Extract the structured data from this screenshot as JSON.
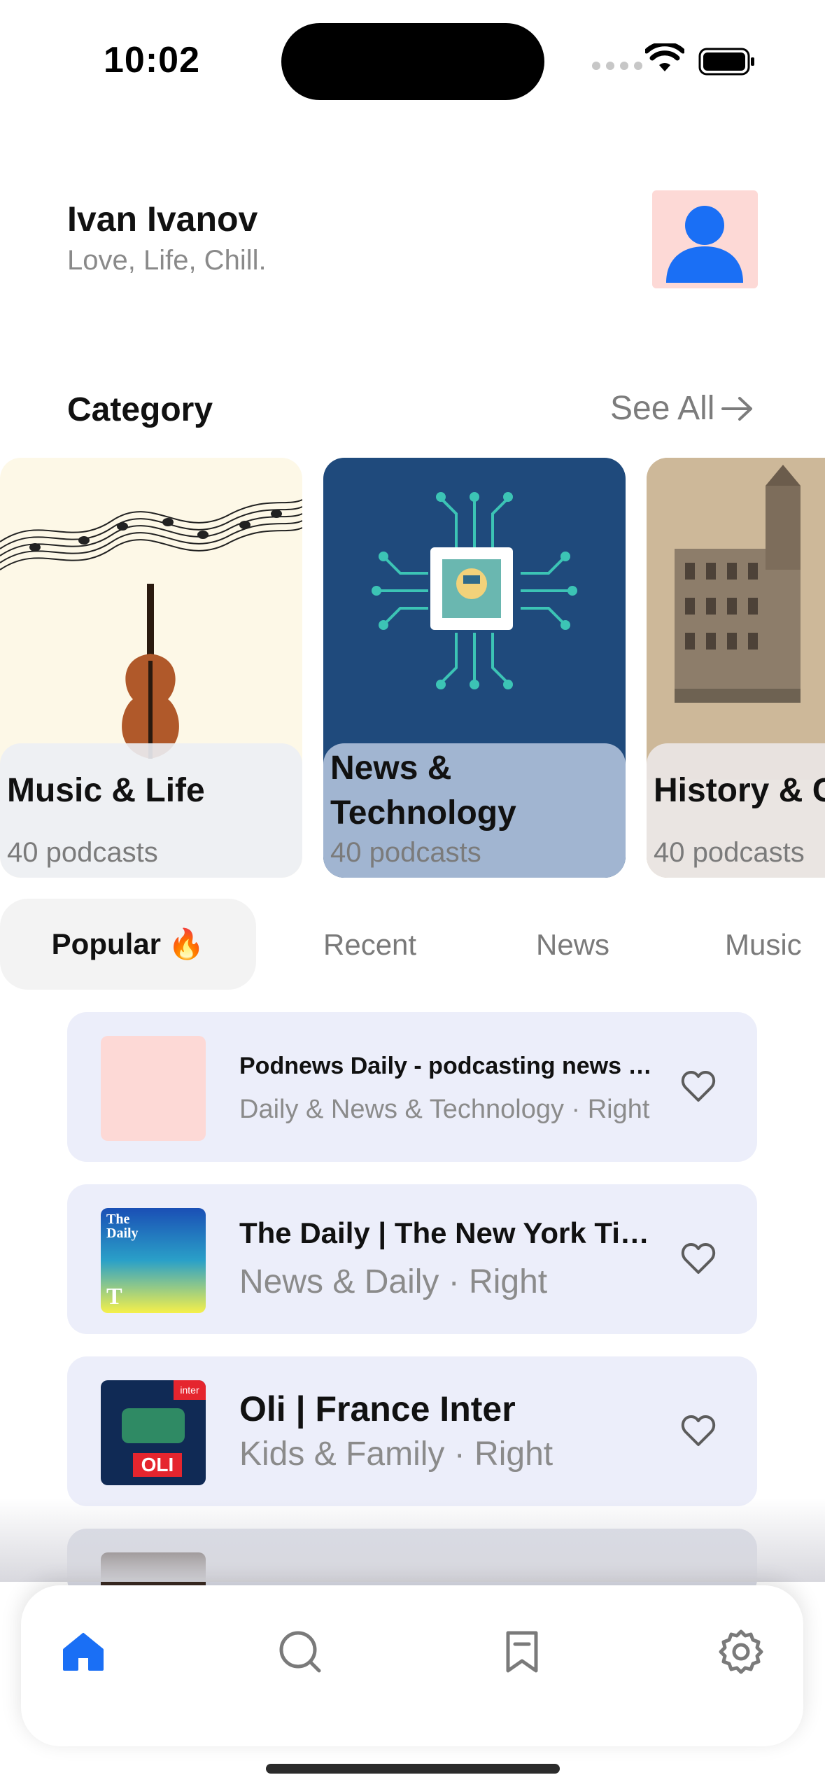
{
  "status_bar": {
    "time": "10:02"
  },
  "header": {
    "name": "Ivan Ivanov",
    "tagline": "Love, Life, Chill."
  },
  "category": {
    "title": "Category",
    "see_all": "See All",
    "cards": [
      {
        "title": "Music & Life",
        "count": "40 podcasts"
      },
      {
        "title_line1": "News &",
        "title_line2": "Technology",
        "count": "40 podcasts"
      },
      {
        "title": "History & C",
        "count": "40 podcasts"
      }
    ]
  },
  "tabs": {
    "active": "Popular",
    "active_emoji": "🔥",
    "recent": "Recent",
    "news": "News",
    "music": "Music"
  },
  "podcasts": [
    {
      "title": "Podnews Daily - podcasting news l...",
      "subtitle": "Daily & News & Technology · Right"
    },
    {
      "title": "The Daily | The New York Times",
      "subtitle": "News & Daily · Right",
      "art_text": "The Daily"
    },
    {
      "title": "Oli | France Inter",
      "subtitle": "Kids & Family · Right",
      "art_text": "OLI",
      "art_badge": "inter"
    }
  ],
  "colors": {
    "accent": "#1a6ff5",
    "card_bg": "#eceefa",
    "avatar_bg": "#fdd9d6"
  },
  "nav": {
    "items": [
      "home-icon",
      "search-icon",
      "bookmark-icon",
      "settings-icon"
    ],
    "active": "home-icon"
  }
}
